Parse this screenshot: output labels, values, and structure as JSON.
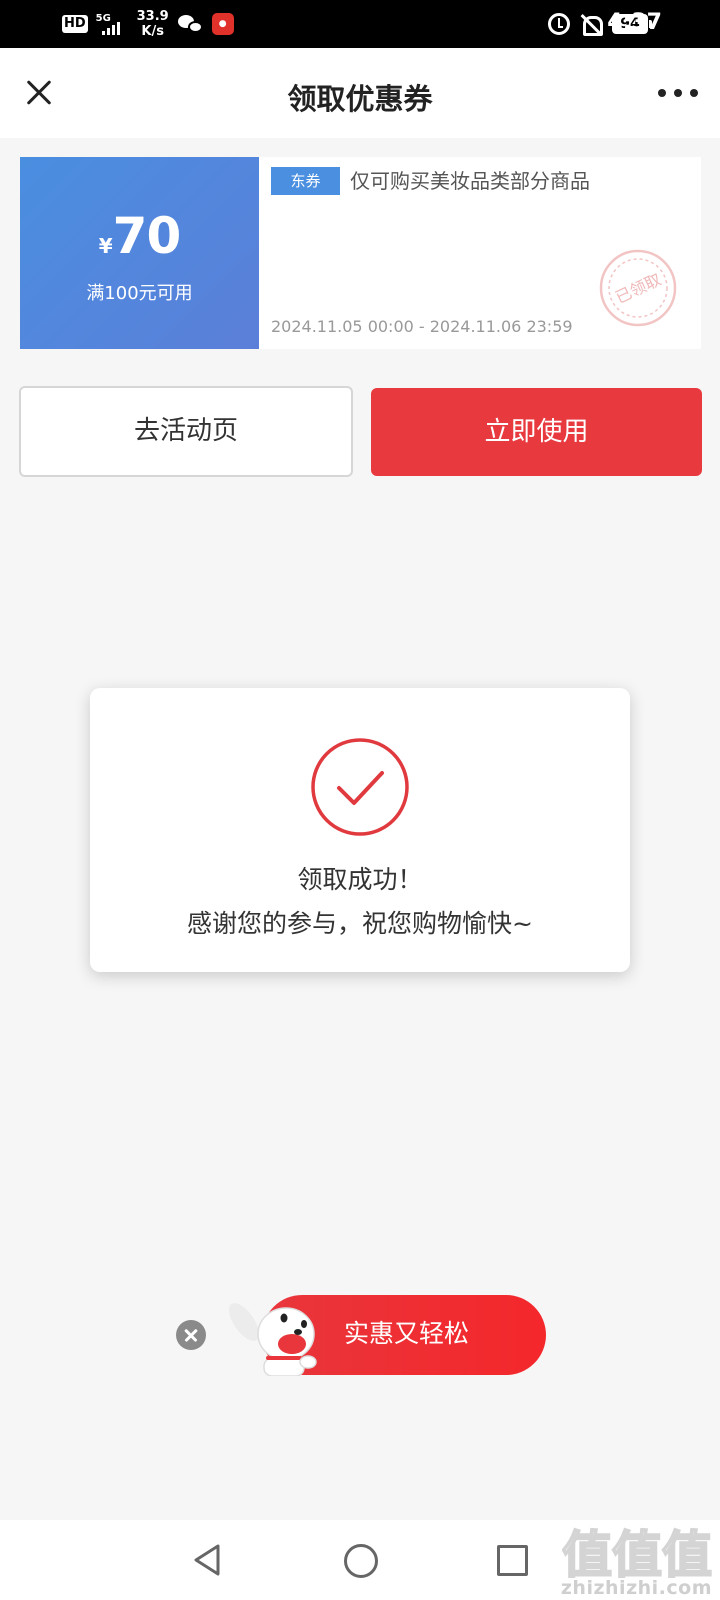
{
  "status_bar": {
    "hd": "HD",
    "network": "5G",
    "speed_value": "33.9",
    "speed_unit": "K/s",
    "battery": "94",
    "time": "4:37"
  },
  "nav": {
    "title": "领取优惠券"
  },
  "coupon": {
    "currency": "¥",
    "amount": "70",
    "condition": "满100元可用",
    "tag": "东券",
    "description": "仅可购买美妆品类部分商品",
    "validity": "2024.11.05 00:00 - 2024.11.06 23:59",
    "stamp_text": "已领取",
    "accent_color": "#4b8fe0"
  },
  "actions": {
    "activity_label": "去活动页",
    "use_label": "立即使用",
    "use_color": "#e8393f"
  },
  "modal": {
    "title": "领取成功！",
    "message": "感谢您的参与，祝您购物愉快~"
  },
  "promo": {
    "label": "实惠又轻松"
  },
  "watermark": {
    "logo_text": "值值值",
    "site": "zhizhizhi.com"
  }
}
